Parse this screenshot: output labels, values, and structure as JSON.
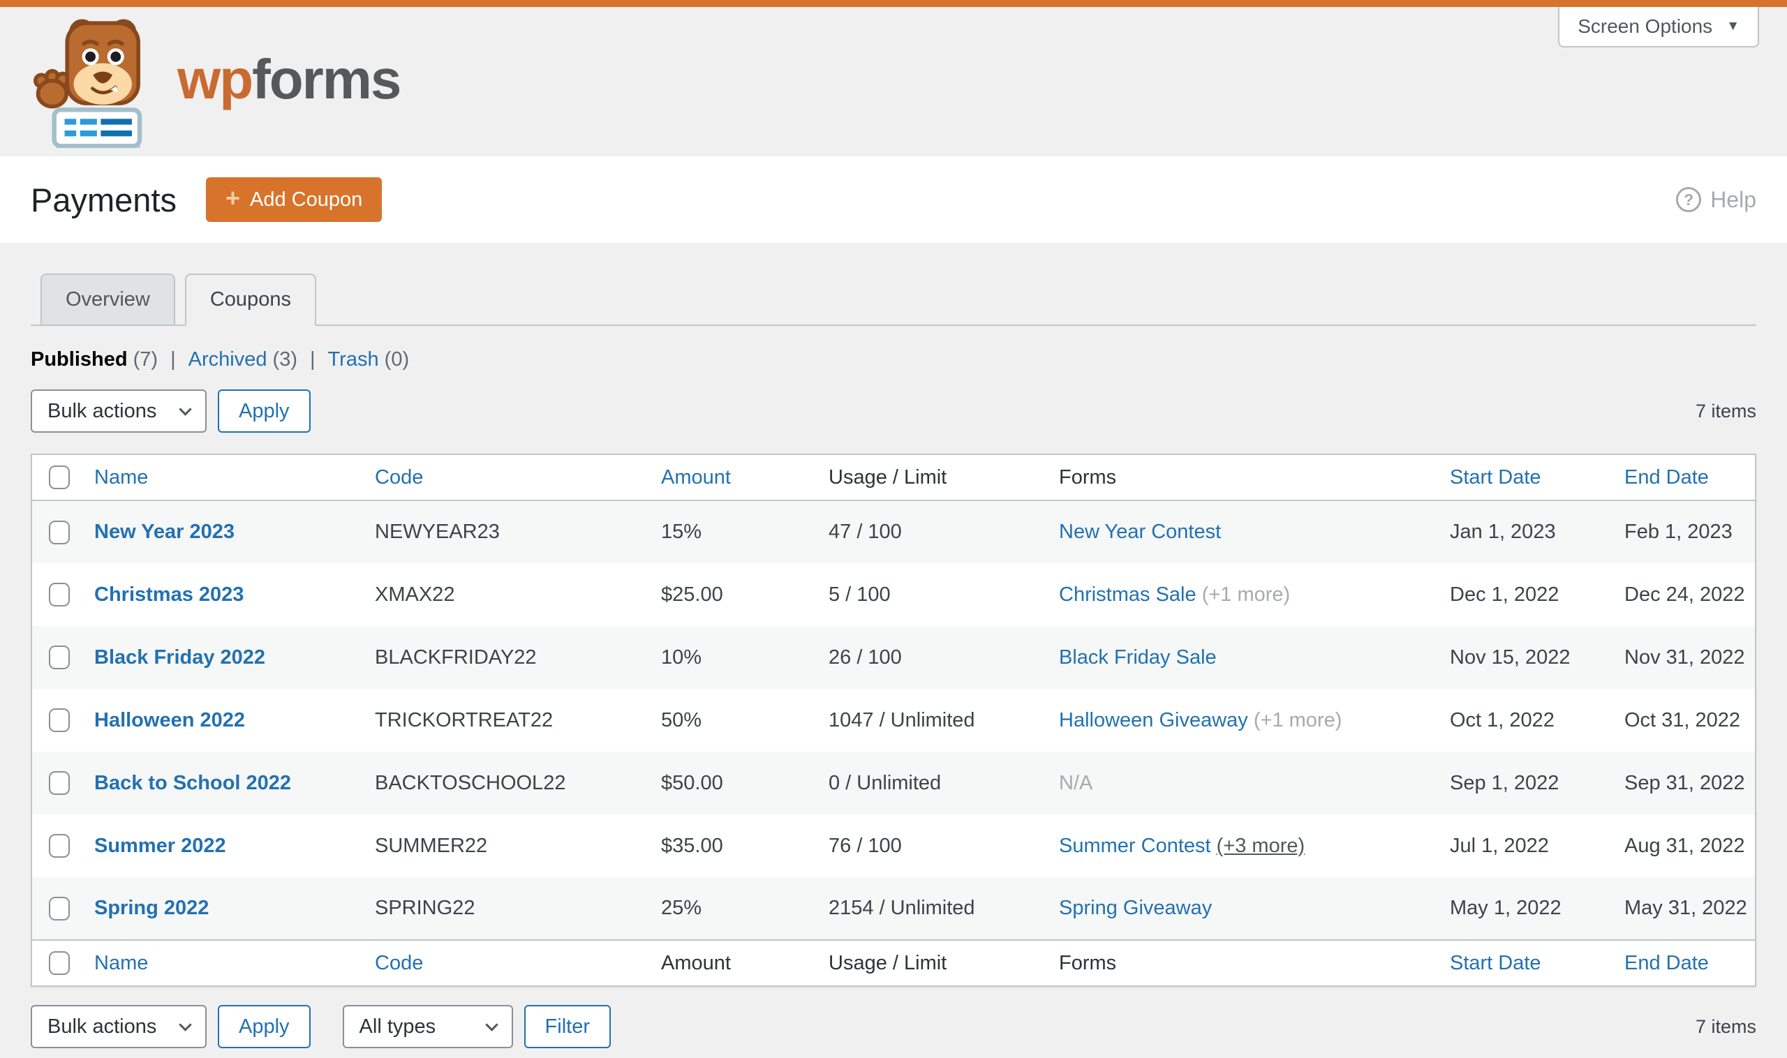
{
  "separators": {
    "pipe": "|"
  },
  "screen_options": {
    "label": "Screen Options",
    "caret": "▼"
  },
  "logo": {
    "brand_prefix": "wp",
    "brand_suffix": "forms"
  },
  "page": {
    "title": "Payments",
    "add_coupon_label": "Add Coupon",
    "plus_glyph": "+",
    "help_label": "Help",
    "help_icon_glyph": "?"
  },
  "tabs": [
    {
      "label": "Overview",
      "active": false
    },
    {
      "label": "Coupons",
      "active": true
    }
  ],
  "status_filters": [
    {
      "label": "Published",
      "count": "(7)",
      "current": true
    },
    {
      "label": "Archived",
      "count": "(3)",
      "current": false
    },
    {
      "label": "Trash",
      "count": "(0)",
      "current": false
    }
  ],
  "toolbar_top": {
    "bulk_actions_label": "Bulk actions",
    "apply_label": "Apply",
    "items_count": "7 items"
  },
  "toolbar_bottom": {
    "bulk_actions_label": "Bulk actions",
    "apply_label": "Apply",
    "type_filter_label": "All types",
    "filter_label": "Filter",
    "items_count": "7 items"
  },
  "colors": {
    "accent_orange": "#d8732b",
    "link_blue": "#2271b1",
    "page_bg": "#f0f0f1",
    "row_stripe": "#f6f7f7",
    "border_gray": "#c3c4c7"
  },
  "table": {
    "columns": [
      {
        "key": "name",
        "label": "Name",
        "top_link": true,
        "bottom_link": true
      },
      {
        "key": "code",
        "label": "Code",
        "top_link": true,
        "bottom_link": true
      },
      {
        "key": "amount",
        "label": "Amount",
        "top_link": true,
        "bottom_link": false
      },
      {
        "key": "usage",
        "label": "Usage / Limit",
        "top_link": false,
        "bottom_link": false
      },
      {
        "key": "forms",
        "label": "Forms",
        "top_link": false,
        "bottom_link": false
      },
      {
        "key": "start",
        "label": "Start Date",
        "top_link": true,
        "bottom_link": true
      },
      {
        "key": "end",
        "label": "End Date",
        "top_link": true,
        "bottom_link": true
      }
    ],
    "rows": [
      {
        "name": "New Year 2023",
        "code": "NEWYEAR23",
        "amount": "15%",
        "usage": "47 / 100",
        "form_link": "New Year Contest",
        "form_note": "",
        "form_note_style": "",
        "form_na": "",
        "start": "Jan 1, 2023",
        "end": "Feb 1, 2023"
      },
      {
        "name": "Christmas 2023",
        "code": "XMAX22",
        "amount": "$25.00",
        "usage": "5 / 100",
        "form_link": "Christmas Sale",
        "form_note": "(+1 more)",
        "form_note_style": "muted",
        "form_na": "",
        "start": "Dec 1, 2022",
        "end": "Dec 24, 2022"
      },
      {
        "name": "Black Friday 2022",
        "code": "BLACKFRIDAY22",
        "amount": "10%",
        "usage": "26 / 100",
        "form_link": "Black Friday Sale",
        "form_note": "",
        "form_note_style": "",
        "form_na": "",
        "start": "Nov 15, 2022",
        "end": "Nov 31, 2022"
      },
      {
        "name": "Halloween 2022",
        "code": "TRICKORTREAT22",
        "amount": "50%",
        "usage": "1047 / Unlimited",
        "form_link": "Halloween Giveaway",
        "form_note": "(+1 more)",
        "form_note_style": "muted",
        "form_na": "",
        "start": "Oct 1, 2022",
        "end": "Oct 31, 2022"
      },
      {
        "name": "Back to School 2022",
        "code": "BACKTOSCHOOL22",
        "amount": "$50.00",
        "usage": "0 / Unlimited",
        "form_link": "",
        "form_note": "",
        "form_note_style": "",
        "form_na": "N/A",
        "start": "Sep 1, 2022",
        "end": "Sep 31, 2022"
      },
      {
        "name": "Summer 2022",
        "code": "SUMMER22",
        "amount": "$35.00",
        "usage": "76 / 100",
        "form_link": "Summer Contest",
        "form_note": "(+3 more)",
        "form_note_style": "link",
        "form_na": "",
        "start": "Jul 1, 2022",
        "end": "Aug 31, 2022"
      },
      {
        "name": "Spring 2022",
        "code": "SPRING22",
        "amount": "25%",
        "usage": "2154 / Unlimited",
        "form_link": "Spring Giveaway",
        "form_note": "",
        "form_note_style": "",
        "form_na": "",
        "start": "May 1, 2022",
        "end": "May 31, 2022"
      }
    ]
  }
}
